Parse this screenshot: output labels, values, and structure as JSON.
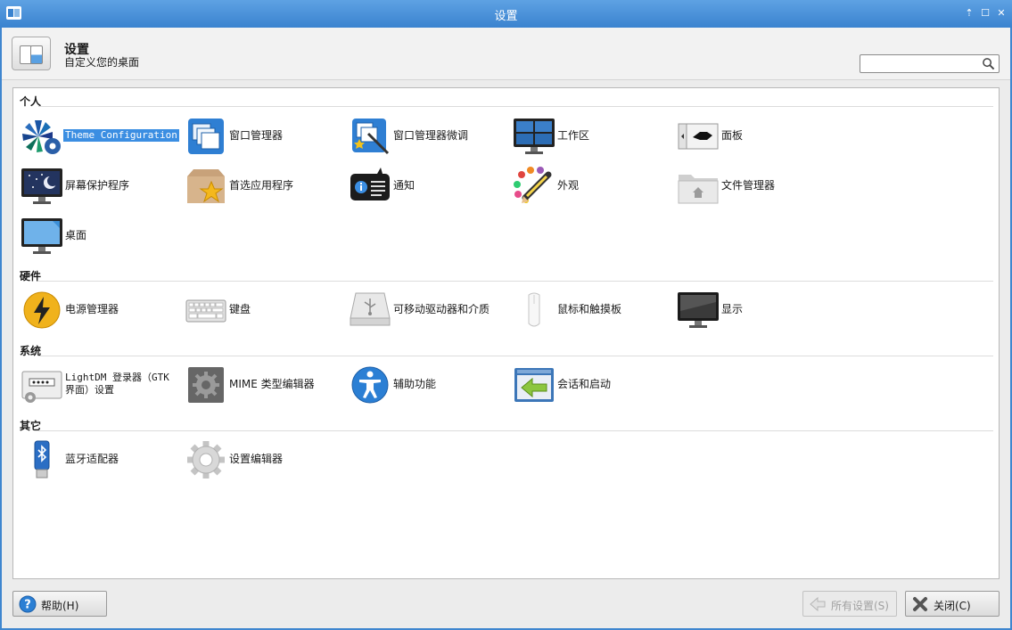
{
  "window": {
    "title": "设置",
    "controls": {
      "restore": "⇡",
      "maximize": "☐",
      "close": "✕"
    }
  },
  "header": {
    "title": "设置",
    "subtitle": "自定义您的桌面",
    "search": {
      "value": "",
      "placeholder": ""
    }
  },
  "sections": [
    {
      "title": "个人",
      "items": [
        {
          "label": "Theme Configuration",
          "icon": "theme-icon",
          "selected": true
        },
        {
          "label": "窗口管理器",
          "icon": "window-manager-icon"
        },
        {
          "label": "窗口管理器微调",
          "icon": "window-tweaks-icon"
        },
        {
          "label": "工作区",
          "icon": "workspaces-icon"
        },
        {
          "label": "面板",
          "icon": "panel-icon"
        },
        {
          "label": "屏幕保护程序",
          "icon": "screensaver-icon"
        },
        {
          "label": "首选应用程序",
          "icon": "preferred-apps-icon"
        },
        {
          "label": "通知",
          "icon": "notifications-icon"
        },
        {
          "label": "外观",
          "icon": "appearance-icon"
        },
        {
          "label": "文件管理器",
          "icon": "file-manager-icon"
        },
        {
          "label": "桌面",
          "icon": "desktop-icon"
        }
      ]
    },
    {
      "title": "硬件",
      "items": [
        {
          "label": "电源管理器",
          "icon": "power-icon"
        },
        {
          "label": "键盘",
          "icon": "keyboard-icon"
        },
        {
          "label": "可移动驱动器和介质",
          "icon": "removable-drive-icon"
        },
        {
          "label": "鼠标和触摸板",
          "icon": "mouse-icon"
        },
        {
          "label": "显示",
          "icon": "display-icon"
        }
      ]
    },
    {
      "title": "系统",
      "items": [
        {
          "label": "LightDM 登录器（GTK 界面）设置",
          "icon": "lightdm-icon"
        },
        {
          "label": "MIME 类型编辑器",
          "icon": "mime-icon"
        },
        {
          "label": "辅助功能",
          "icon": "accessibility-icon"
        },
        {
          "label": "会话和启动",
          "icon": "session-icon"
        }
      ]
    },
    {
      "title": "其它",
      "items": [
        {
          "label": "蓝牙适配器",
          "icon": "bluetooth-icon"
        },
        {
          "label": "设置编辑器",
          "icon": "settings-editor-icon"
        }
      ]
    }
  ],
  "footer": {
    "help": "帮助(H)",
    "all_settings": "所有设置(S)",
    "close": "关闭(C)"
  },
  "colors": {
    "titlebar": "#3f86cf",
    "selection": "#3b8ee2"
  }
}
